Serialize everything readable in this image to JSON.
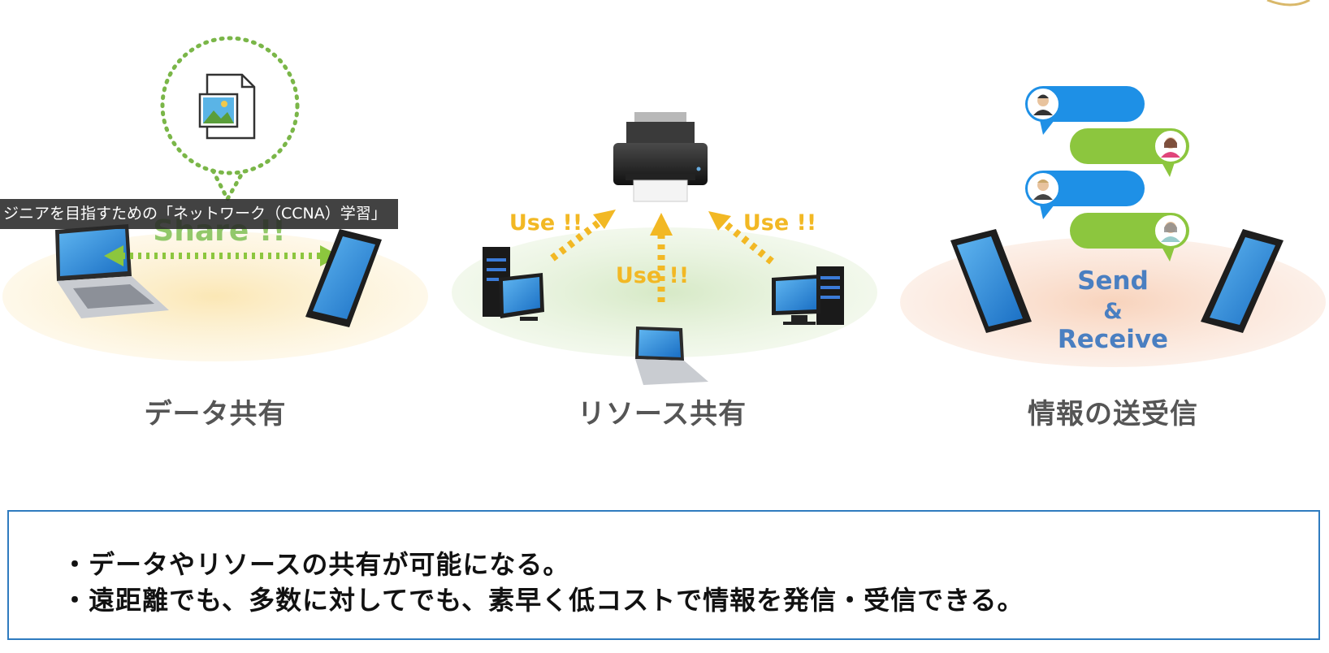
{
  "tooltip": "ジニアを目指すための「ネットワーク（CCNA）学習」",
  "sections": [
    {
      "caption": "データ共有",
      "label": "Share !!"
    },
    {
      "caption": "リソース共有",
      "labels": [
        "Use !!",
        "Use !!",
        "Use !!"
      ]
    },
    {
      "caption": "情報の送受信",
      "label_lines": [
        "Send",
        "&",
        "Receive"
      ]
    }
  ],
  "summary": {
    "lines": [
      "・データやリソースの共有が可能になる。",
      "・遠距離でも、多数に対してでも、素早く低コストで情報を発信・受信できる。"
    ]
  },
  "colors": {
    "green_accent": "#7ab648",
    "yellow_accent": "#f2b824",
    "blue_text": "#4a7fc1",
    "box_border": "#2f7bbf",
    "bubble_blue": "#1e90e6",
    "bubble_green": "#8cc63e"
  }
}
